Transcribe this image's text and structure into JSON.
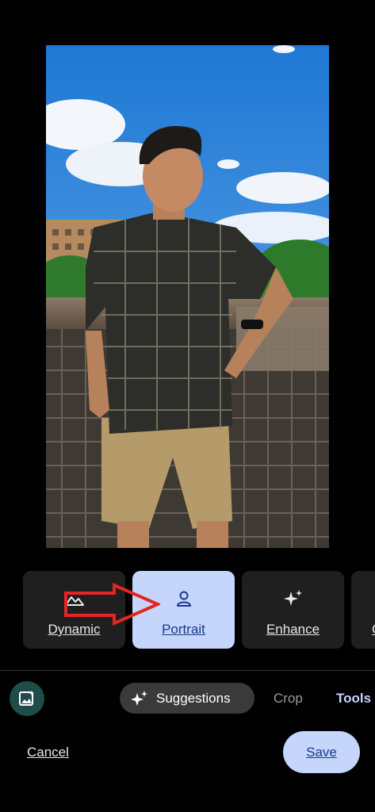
{
  "photo": {
    "subject": "portrait-photo"
  },
  "effects": {
    "items": [
      {
        "label": "Dynamic",
        "icon": "landscape-icon",
        "selected": false
      },
      {
        "label": "Portrait",
        "icon": "person-icon",
        "selected": true
      },
      {
        "label": "Enhance",
        "icon": "sparkle-icon",
        "selected": false
      },
      {
        "label": "C",
        "icon": "partial-icon",
        "selected": false
      }
    ]
  },
  "annotation": {
    "arrow_color": "#e52521",
    "points_to": "Portrait"
  },
  "tabs": {
    "suggestions_label": "Suggestions",
    "crop_label": "Crop",
    "tools_label": "Tools",
    "active": "Suggestions"
  },
  "actions": {
    "cancel_label": "Cancel",
    "save_label": "Save"
  },
  "colors": {
    "background": "#000000",
    "accent": "#c6d5fb",
    "accent_text": "#1b3a8e",
    "chip_bg": "#1f1f1f"
  }
}
